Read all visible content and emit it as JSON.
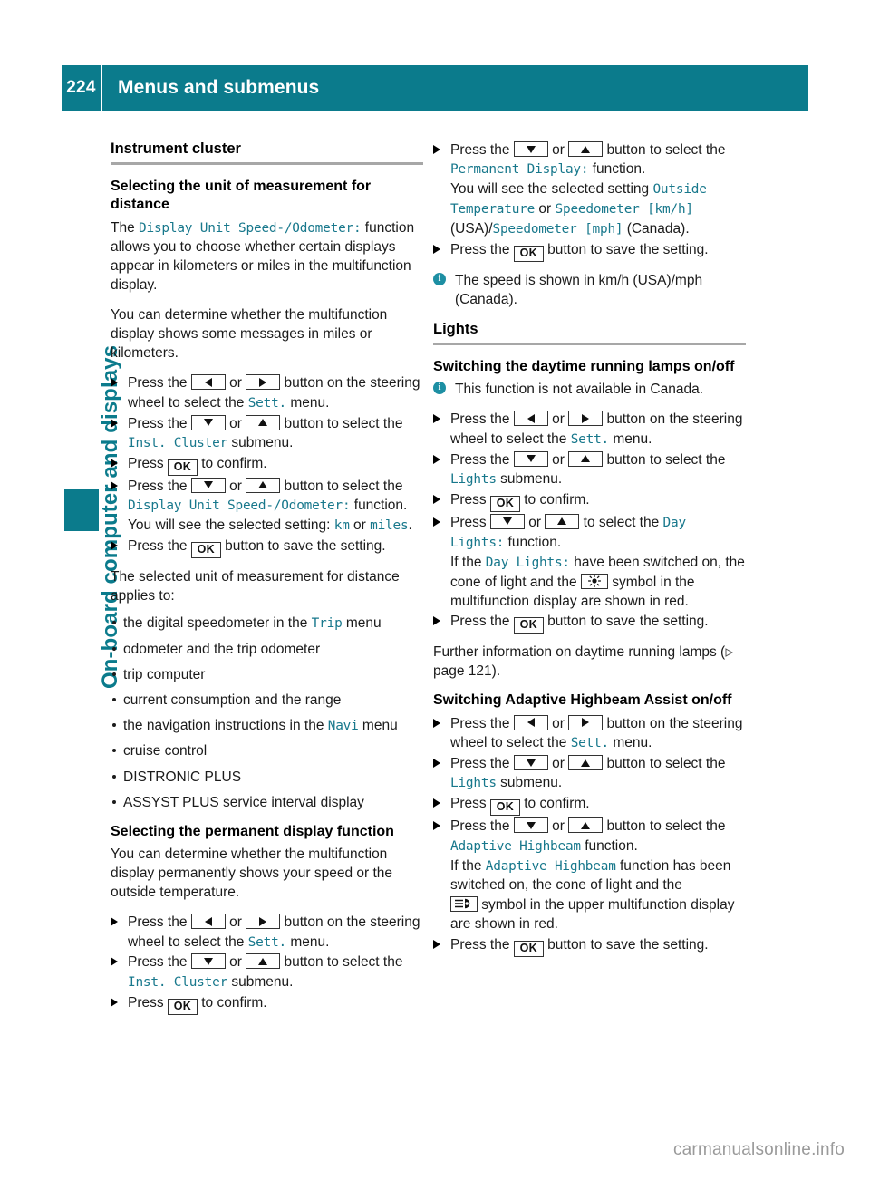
{
  "header": {
    "page_number": "224",
    "title": "Menus and submenus"
  },
  "sidebar": {
    "chapter_label": "On-board computer and displays"
  },
  "footer": {
    "watermark": "carmanualsonline.info"
  },
  "left_column": {
    "section_title": "Instrument cluster",
    "sub1": {
      "heading": "Selecting the unit of measurement for distance",
      "p1_a": "The ",
      "p1_mono": "Display Unit Speed-/Odometer:",
      "p1_b": " function allows you to choose whether certain displays appear in kilometers or miles in the multifunction display.",
      "p2": "You can determine whether the multifunction display shows some messages in miles or kilometers.",
      "steps": {
        "s1_a": "Press the ",
        "s1_b": " or ",
        "s1_c": " button on the steering wheel to select the ",
        "s1_mono": "Sett.",
        "s1_d": " menu.",
        "s2_a": "Press the ",
        "s2_b": " or ",
        "s2_c": " button to select the ",
        "s2_mono": "Inst. Cluster",
        "s2_d": " submenu.",
        "s3_a": "Press ",
        "s3_b": " to confirm.",
        "s4_a": "Press the ",
        "s4_b": " or ",
        "s4_c": " button to select the ",
        "s4_mono": "Display Unit Speed-/Odometer:",
        "s4_d": " function.",
        "s4_e": "You will see the selected setting: ",
        "s4_mono2": "km",
        "s4_f": " or ",
        "s4_mono3": "miles",
        "s4_g": ".",
        "s5_a": "Press the ",
        "s5_b": " button to save the setting."
      },
      "p3": "The selected unit of measurement for distance applies to:",
      "applies_to": [
        {
          "a": "the digital speedometer in the ",
          "mono": "Trip",
          "b": " menu"
        },
        {
          "a": "odometer and the trip odometer",
          "mono": "",
          "b": ""
        },
        {
          "a": "trip computer",
          "mono": "",
          "b": ""
        },
        {
          "a": "current consumption and the range",
          "mono": "",
          "b": ""
        },
        {
          "a": "the navigation instructions in the ",
          "mono": "Navi",
          "b": " menu"
        },
        {
          "a": "cruise control",
          "mono": "",
          "b": ""
        },
        {
          "a": "DISTRONIC PLUS",
          "mono": "",
          "b": ""
        },
        {
          "a": "ASSYST PLUS service interval display",
          "mono": "",
          "b": ""
        }
      ]
    },
    "sub2": {
      "heading": "Selecting the permanent display function",
      "p1": "You can determine whether the multifunction display permanently shows your speed or the outside temperature.",
      "steps": {
        "s1_a": "Press the ",
        "s1_b": " or ",
        "s1_c": " button on the steering wheel to select the ",
        "s1_mono": "Sett.",
        "s1_d": " menu.",
        "s2_a": "Press the ",
        "s2_b": " or ",
        "s2_c": " button to select the ",
        "s2_mono": "Inst. Cluster",
        "s2_d": " submenu.",
        "s3_a": "Press ",
        "s3_b": " to confirm."
      }
    }
  },
  "right_column": {
    "cont_steps": {
      "s1_a": "Press the ",
      "s1_b": " or ",
      "s1_c": " button to select the ",
      "s1_mono": "Permanent Display:",
      "s1_d": " function.",
      "s1_e": "You will see the selected setting ",
      "s1_mono2": "Outside Temperature",
      "s1_f": " or ",
      "s1_mono3": "Speedometer [km/h]",
      "s1_g": " (USA)/",
      "s1_mono4": "Speedometer [mph]",
      "s1_h": " (Canada).",
      "s2_a": "Press the ",
      "s2_b": " button to save the setting."
    },
    "note1": "The speed is shown in km/h (USA)/mph (Canada).",
    "section_title": "Lights",
    "sub1": {
      "heading": "Switching the daytime running lamps on/off",
      "note": "This function is not available in Canada.",
      "steps": {
        "s1_a": "Press the ",
        "s1_b": " or ",
        "s1_c": " button on the steering wheel to select the ",
        "s1_mono": "Sett.",
        "s1_d": " menu.",
        "s2_a": "Press the ",
        "s2_b": " or ",
        "s2_c": " button to select the ",
        "s2_mono": "Lights",
        "s2_d": " submenu.",
        "s3_a": "Press ",
        "s3_b": " to confirm.",
        "s4_a": "Press ",
        "s4_b": " or ",
        "s4_c": " to select the ",
        "s4_mono": "Day Lights:",
        "s4_d": " function.",
        "s4_e": "If the ",
        "s4_mono2": "Day Lights:",
        "s4_f": " have been switched on, the cone of light and the ",
        "s4_g": " symbol in the multifunction display are shown in red.",
        "s5_a": "Press the ",
        "s5_b": " button to save the setting."
      },
      "further_a": "Further information on daytime running lamps (",
      "further_page": "page 121",
      "further_b": ")."
    },
    "sub2": {
      "heading": "Switching Adaptive Highbeam Assist on/off",
      "steps": {
        "s1_a": "Press the ",
        "s1_b": " or ",
        "s1_c": " button on the steering wheel to select the ",
        "s1_mono": "Sett.",
        "s1_d": " menu.",
        "s2_a": "Press the ",
        "s2_b": " or ",
        "s2_c": " button to select the ",
        "s2_mono": "Lights",
        "s2_d": " submenu.",
        "s3_a": "Press ",
        "s3_b": " to confirm.",
        "s4_a": "Press the ",
        "s4_b": " or ",
        "s4_c": " button to select the ",
        "s4_mono": "Adaptive Highbeam",
        "s4_d": " function.",
        "s4_e": "If the ",
        "s4_mono2": "Adaptive Highbeam",
        "s4_f": " function has been switched on, the cone of light and the ",
        "s4_g": " symbol in the upper multifunction display are shown in red.",
        "s5_a": "Press the ",
        "s5_b": " button to save the setting."
      }
    }
  },
  "icons": {
    "ok_label": "OK",
    "info_glyph": "i"
  },
  "colors": {
    "teal": "#0b7b8c",
    "mono_text": "#18788c",
    "rule": "#a7a7a7",
    "watermark": "#9a9a9a"
  }
}
